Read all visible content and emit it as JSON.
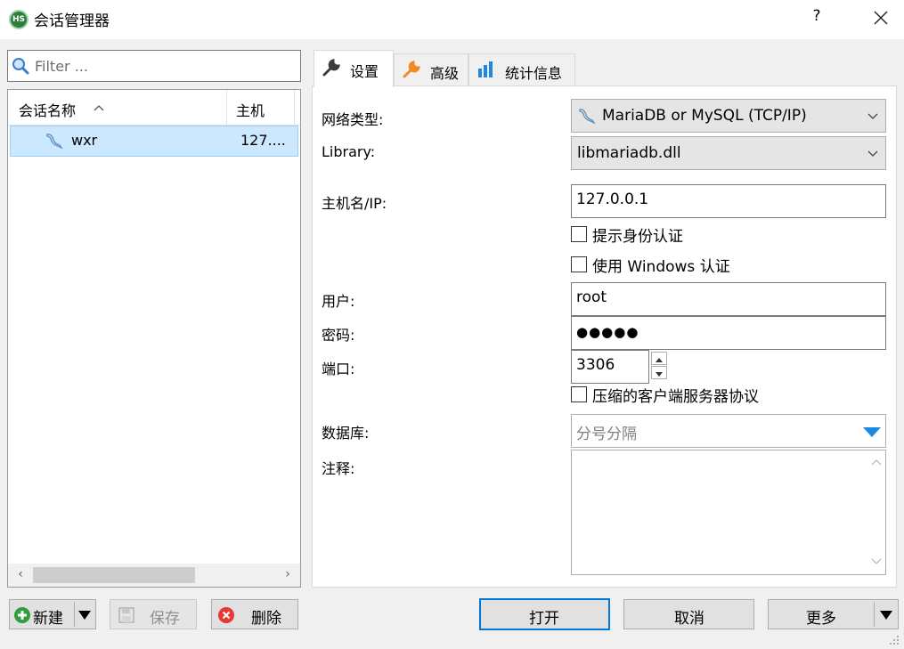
{
  "window": {
    "title": "会话管理器",
    "icon_text": "HS",
    "help": "?"
  },
  "filter": {
    "placeholder": "Filter ..."
  },
  "tree": {
    "columns": {
      "name": "会话名称",
      "host": "主机"
    },
    "rows": [
      {
        "name": "wxr",
        "host": "127...."
      }
    ]
  },
  "tabs": {
    "settings": "设置",
    "advanced": "高级",
    "stats": "统计信息"
  },
  "settings": {
    "network_type": {
      "label": "网络类型:",
      "value": "MariaDB or MySQL (TCP/IP)"
    },
    "library": {
      "label": "Library:",
      "value": "libmariadb.dll"
    },
    "hostname": {
      "label": "主机名/IP:",
      "value": "127.0.0.1"
    },
    "prompt_auth": {
      "label": "提示身份认证",
      "checked": false
    },
    "windows_auth": {
      "label": "使用 Windows 认证",
      "checked": false
    },
    "user": {
      "label": "用户:",
      "value": "root"
    },
    "password": {
      "label": "密码:",
      "value": "●●●●●"
    },
    "port": {
      "label": "端口:",
      "value": "3306"
    },
    "compressed": {
      "label": "压缩的客户端服务器协议",
      "checked": false
    },
    "databases": {
      "label": "数据库:",
      "placeholder": "分号分隔"
    },
    "comment": {
      "label": "注释:",
      "value": ""
    }
  },
  "buttons": {
    "new": "新建",
    "save": "保存",
    "delete": "删除",
    "open": "打开",
    "cancel": "取消",
    "more": "更多"
  },
  "colors": {
    "selection": "#cce8ff",
    "accent": "#0078d7",
    "delete_red": "#e53935",
    "new_green": "#2e9e3e",
    "stats_blue": "#1e88e5",
    "wrench_orange": "#f08a24"
  }
}
